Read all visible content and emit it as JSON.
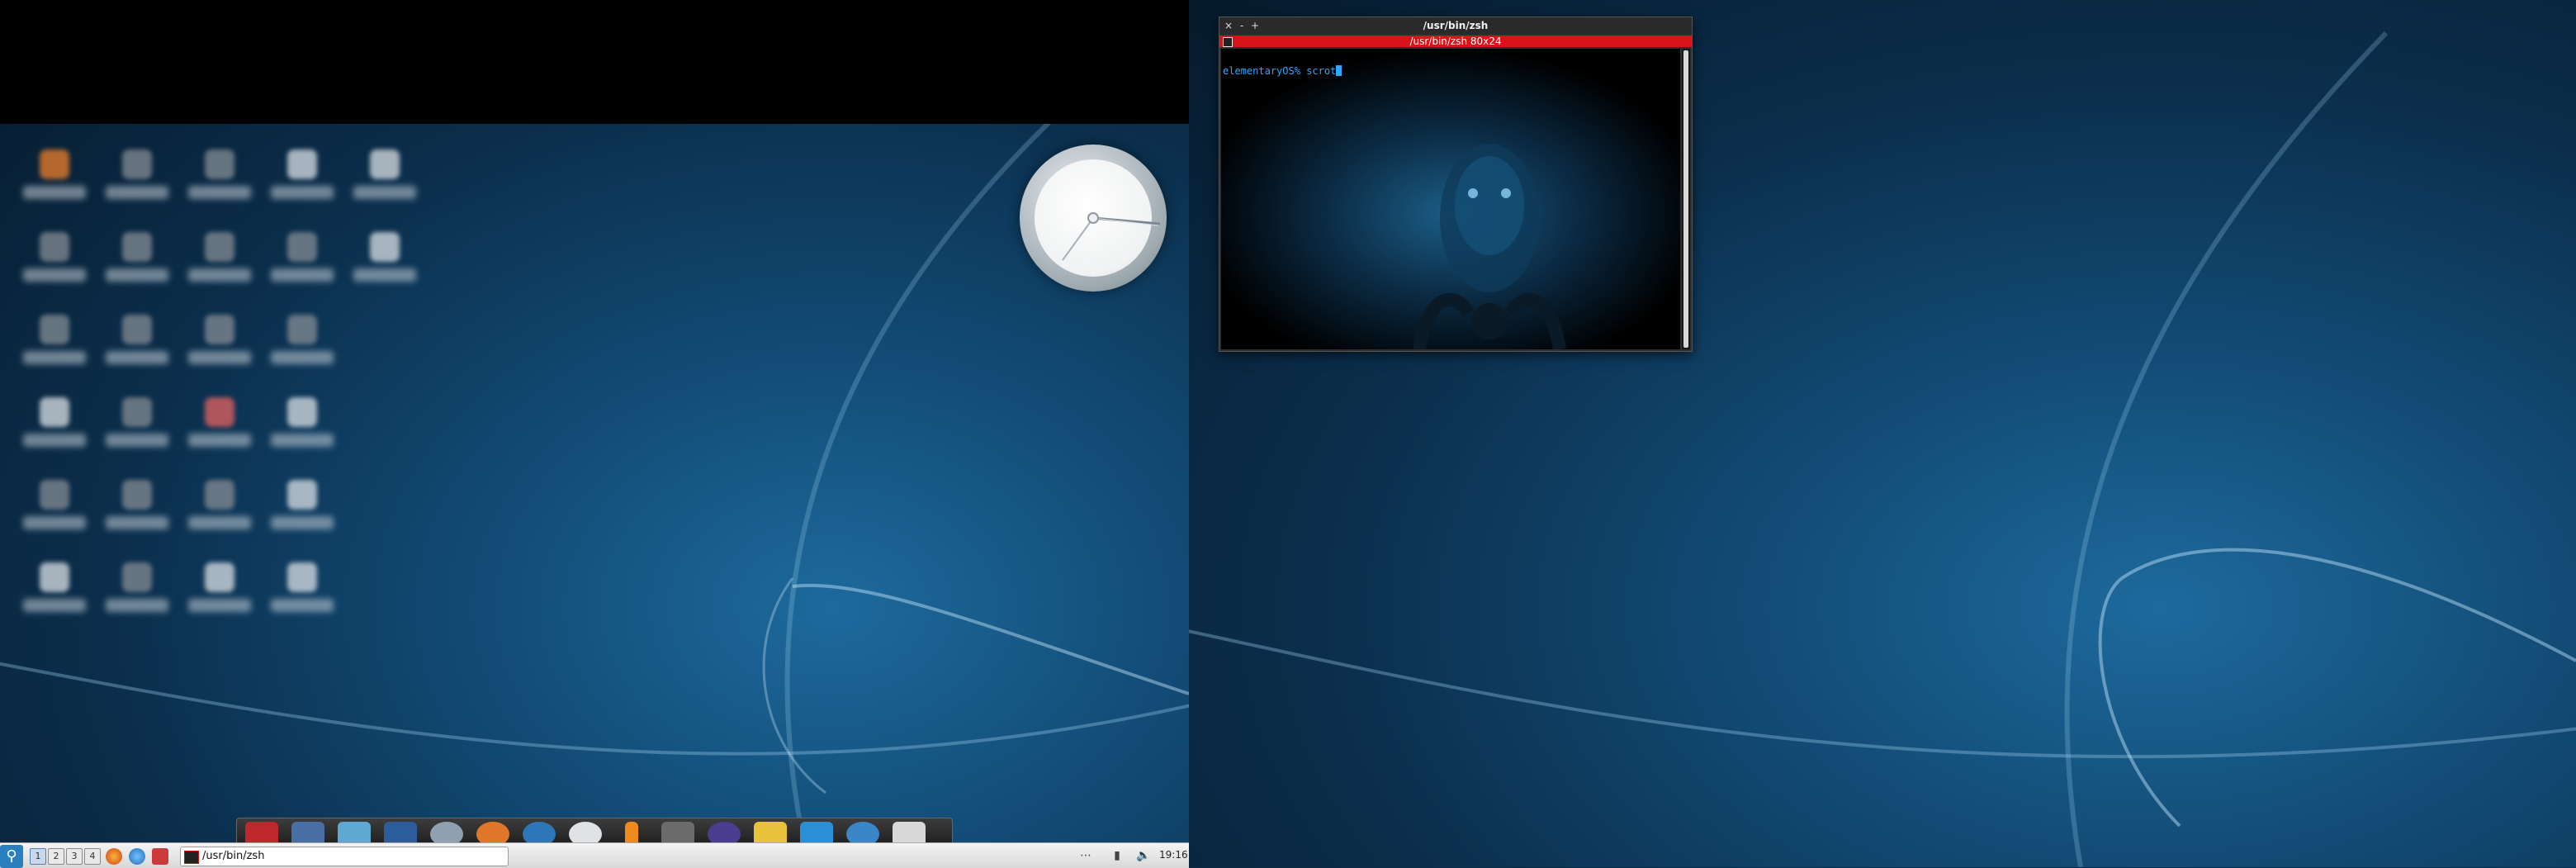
{
  "terminal": {
    "window_title": "/usr/bin/zsh",
    "tab_title": "/usr/bin/zsh 80x24",
    "prompt": "elementaryOS% scrot",
    "window_buttons": {
      "close": "×",
      "minimize": "-",
      "maximize": "+"
    }
  },
  "taskbar": {
    "workspaces": [
      "1",
      "2",
      "3",
      "4"
    ],
    "active_workspace": "1",
    "task_label": "/usr/bin/zsh",
    "clock": "19:16"
  },
  "desktop": {
    "icon_count": 26,
    "analog_clock_icon": "analog-clock-widget"
  },
  "icons": {
    "menu": "app-menu-icon",
    "firefox": "firefox-icon",
    "chromium": "chromium-icon",
    "tool": "tool-icon",
    "wifi": "network-icon",
    "battery": "battery-icon",
    "volume": "volume-icon"
  },
  "colors": {
    "terminal_tab": "#d6141a",
    "prompt_text": "#2ea9ff",
    "panel": "#e6e6e6"
  }
}
